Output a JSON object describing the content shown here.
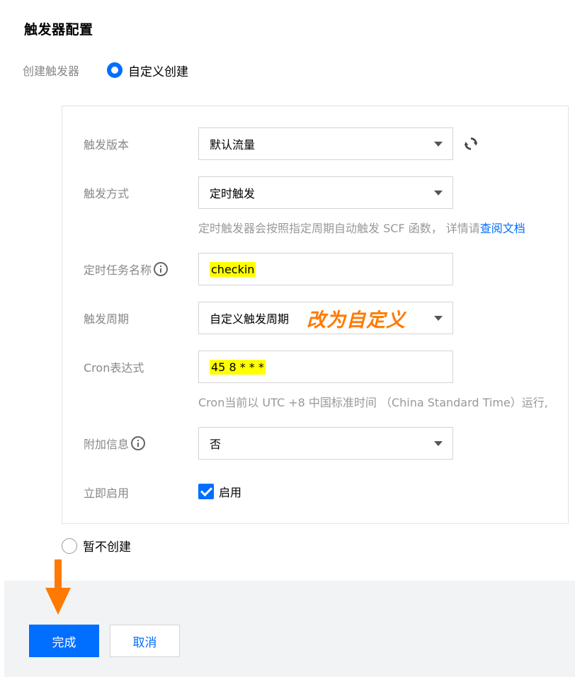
{
  "title": "触发器配置",
  "create_trigger": {
    "label": "创建触发器",
    "option_custom": "自定义创建",
    "option_skip": "暂不创建"
  },
  "form": {
    "version": {
      "label": "触发版本",
      "value": "默认流量"
    },
    "method": {
      "label": "触发方式",
      "value": "定时触发",
      "hint_prefix": "定时触发器会按照指定周期自动触发 SCF 函数， 详情请",
      "hint_link": "查阅文档"
    },
    "task_name": {
      "label": "定时任务名称",
      "value": "checkin"
    },
    "period": {
      "label": "触发周期",
      "value": "自定义触发周期"
    },
    "cron": {
      "label": "Cron表达式",
      "value": "45 8 * * *",
      "hint": "Cron当前以 UTC +8 中国标准时间 （China Standard Time）运行,"
    },
    "extra": {
      "label": "附加信息",
      "value": "否"
    },
    "enable": {
      "label": "立即启用",
      "checkbox_label": "启用",
      "checked": true
    }
  },
  "annotation": "改为自定义",
  "buttons": {
    "confirm": "完成",
    "cancel": "取消"
  },
  "colors": {
    "accent": "#006eff",
    "annotation": "#ff7a00",
    "highlight": "#ffff00"
  },
  "icons": [
    "refresh-icon",
    "info-icon",
    "caret-down-icon",
    "checkmark-icon",
    "arrow-down-icon"
  ]
}
